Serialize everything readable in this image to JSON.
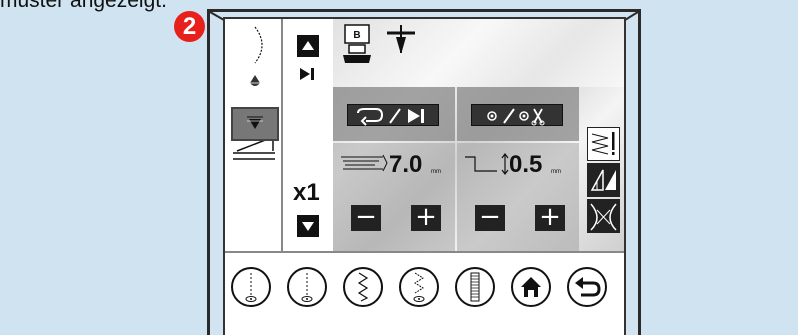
{
  "caption": "muster angezeigt.",
  "step_badge": "2",
  "screen": {
    "foot_letter": "B",
    "repeat_counter": "x1",
    "length": {
      "value": "7.0",
      "unit": "mm"
    },
    "width": {
      "value": "0.5",
      "unit": "mm"
    },
    "minus": "−",
    "plus": "+"
  },
  "icons": {
    "left_panel": [
      "stitch-arc-icon",
      "drop-icon",
      "triangle-down-icon",
      "slope-icon"
    ],
    "controls": [
      "up-arrow-button-icon",
      "pattern-end-icon",
      "down-arrow-button-icon"
    ],
    "top": [
      "presser-foot-icon",
      "needle-icon"
    ],
    "actions": [
      "repeat-end-icon",
      "tie-off-cut-icon"
    ],
    "right_column": [
      "stitch-density-icon",
      "tapering-icon",
      "mirror-icon"
    ],
    "bottom": [
      "straight-stitch-icon",
      "straight-stitch-alt-icon",
      "zigzag-icon",
      "triple-zigzag-icon",
      "satin-bar-icon",
      "home-icon",
      "back-icon"
    ]
  },
  "colors": {
    "badge": "#e8201c",
    "background": "#cfe3f1",
    "dark_button": "#222222"
  }
}
